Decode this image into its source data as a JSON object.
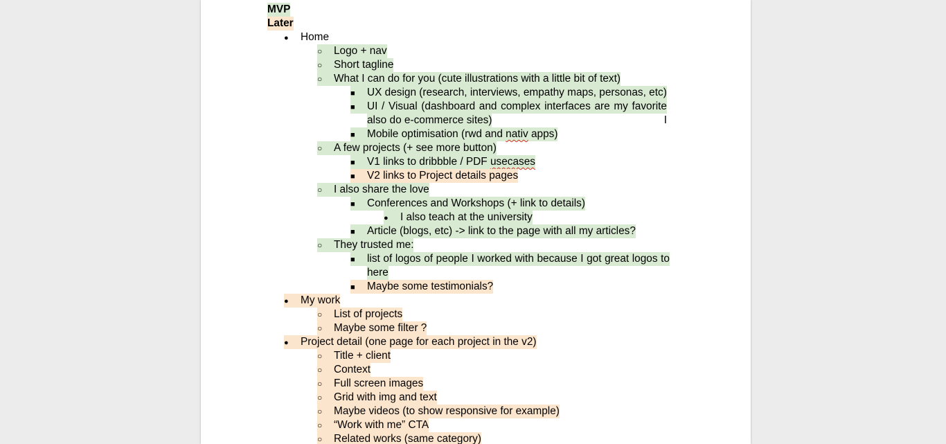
{
  "legend": {
    "mvp_label": "MVP",
    "later_label": "Later"
  },
  "colors": {
    "mvp_highlight": "#d9ead3",
    "later_highlight": "#fce5cd",
    "page_background": "#ffffff",
    "workspace_background": "#ececec"
  },
  "outline": {
    "home": {
      "label": "Home",
      "logo_nav": "Logo + nav",
      "tagline": "Short tagline",
      "what_i_do": "What I can do for you (cute illustrations with a little bit of text)",
      "ux": "UX design (research, interviews, empathy maps, personas, etc)",
      "ui_line1": "UI / Visual (dashboard and complex interfaces are my favorite but I",
      "ui_line2": "also do e-commerce sites)",
      "mobile_pre": "Mobile optimisation (rwd and ",
      "mobile_misspelled": "nativ",
      "mobile_post": " apps)",
      "projects": "A few projects (+ see more button)",
      "v1_pre": "V1 links to dribbble / PDF ",
      "v1_misspelled": "usecases",
      "v2": "V2 links to Project details pages",
      "share": "I also share the love",
      "conferences": "Conferences and Workshops (+ link to details)",
      "teach": "I also teach at the university",
      "article": "Article (blogs, etc) -> link to the page with all my articles?",
      "trusted": "They trusted me:",
      "logos_line1": "list of logos of people I worked with because I got great logos to put",
      "logos_line2": "here",
      "testimonials": "Maybe some testimonials?"
    },
    "my_work": {
      "label": "My work",
      "list": "List of projects",
      "filter": "Maybe some filter ?"
    },
    "project_detail": {
      "label": "Project detail (one page for each project in the v2)",
      "title": "Title + client",
      "context": "Context",
      "images": "Full screen images",
      "grid": "Grid with img and text",
      "videos": "Maybe videos (to show responsive for example)",
      "cta": "“Work with me” CTA",
      "related": "Related works (same category)"
    }
  }
}
